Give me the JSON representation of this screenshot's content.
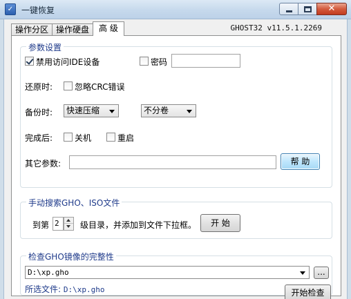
{
  "window": {
    "title": "一键恢复",
    "app_icon_glyph": "✓",
    "close_glyph": "✕",
    "version": "GHOST32 v11.5.1.2269"
  },
  "tabs": [
    {
      "label": "操作分区",
      "active": false
    },
    {
      "label": "操作硬盘",
      "active": false
    },
    {
      "label": "高 级",
      "active": true
    }
  ],
  "params": {
    "title": "参数设置",
    "disable_ide_label": "禁用访问IDE设备",
    "disable_ide_checked": true,
    "password_label": "密码",
    "password_checked": false,
    "password_value": "",
    "restore_label": "还原时:",
    "ignore_crc_label": "忽略CRC错误",
    "ignore_crc_checked": false,
    "backup_label": "备份时:",
    "compression_selected": "快速压缩",
    "split_selected": "不分卷",
    "after_label": "完成后:",
    "shutdown_label": "关机",
    "shutdown_checked": false,
    "restart_label": "重启",
    "restart_checked": false,
    "other_params_label": "其它参数:",
    "other_params_value": "",
    "help_button": "帮 助"
  },
  "search": {
    "title": "手动搜索GHO、ISO文件",
    "prefix": "到第",
    "level_value": "2",
    "suffix": "级目录，并添加到文件下拉框。",
    "start_button": "开 始"
  },
  "check": {
    "title": "检查GHO镜像的完整性",
    "file_selected": "D:\\xp.gho",
    "browse_button": "...",
    "selected_label": "所选文件:",
    "selected_file": "D:\\xp.gho",
    "start_check_button": "开始检查"
  },
  "colors": {
    "group_title": "#1e3a8a",
    "focused_button": "#bee6fd"
  }
}
